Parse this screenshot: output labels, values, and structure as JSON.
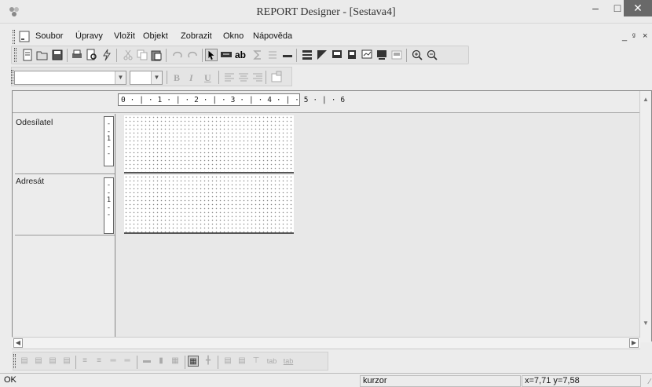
{
  "window": {
    "title": "REPORT Designer - [Sestava4]",
    "minimize_glyph": "–",
    "maximize_glyph": "□",
    "close_glyph": "✕"
  },
  "menu": {
    "items": [
      "Soubor",
      "Úpravy",
      "Vložit",
      "Objekt",
      "Zobrazit",
      "Okno",
      "Nápověda"
    ],
    "mdi_controls": "_ ̅̅  ×"
  },
  "mdi": {
    "minimize": "_",
    "restore": "ȅ",
    "close": "×"
  },
  "toolbar_main": {
    "icons": [
      "new-icon",
      "open-icon",
      "save-icon",
      "print-icon",
      "print-preview-icon",
      "lightning-icon",
      "cut-icon",
      "copy-icon",
      "paste-icon",
      "undo-icon",
      "redo-icon",
      "pointer-icon",
      "text-field-icon",
      "ab-label-icon",
      "sum-icon",
      "list-icon",
      "line-icon",
      "group-header-icon",
      "picture-icon",
      "frame-icon",
      "subreport-icon",
      "chart-icon",
      "db-field-icon",
      "band-icon",
      "zoom-in-icon",
      "zoom-out-icon"
    ]
  },
  "toolbar_format": {
    "font_value": "",
    "size_value": "",
    "bold": "B",
    "italic": "I",
    "underline": "U"
  },
  "ruler": {
    "text": "0 · | · 1 · | · 2 · | · 3 · | · 4 · | · 5 · | · 6"
  },
  "bands": [
    {
      "label": "Odesílatel",
      "vruler": [
        "-",
        "-",
        "1",
        "-",
        "-"
      ]
    },
    {
      "label": "Adresát",
      "vruler": [
        "-",
        "-",
        "1",
        "-",
        "-"
      ]
    }
  ],
  "toolbar_align": {
    "labels": [
      "tab",
      "tab"
    ]
  },
  "status": {
    "message": "OK",
    "mode": "kurzor",
    "coords": "x=7,71  y=7,58"
  }
}
